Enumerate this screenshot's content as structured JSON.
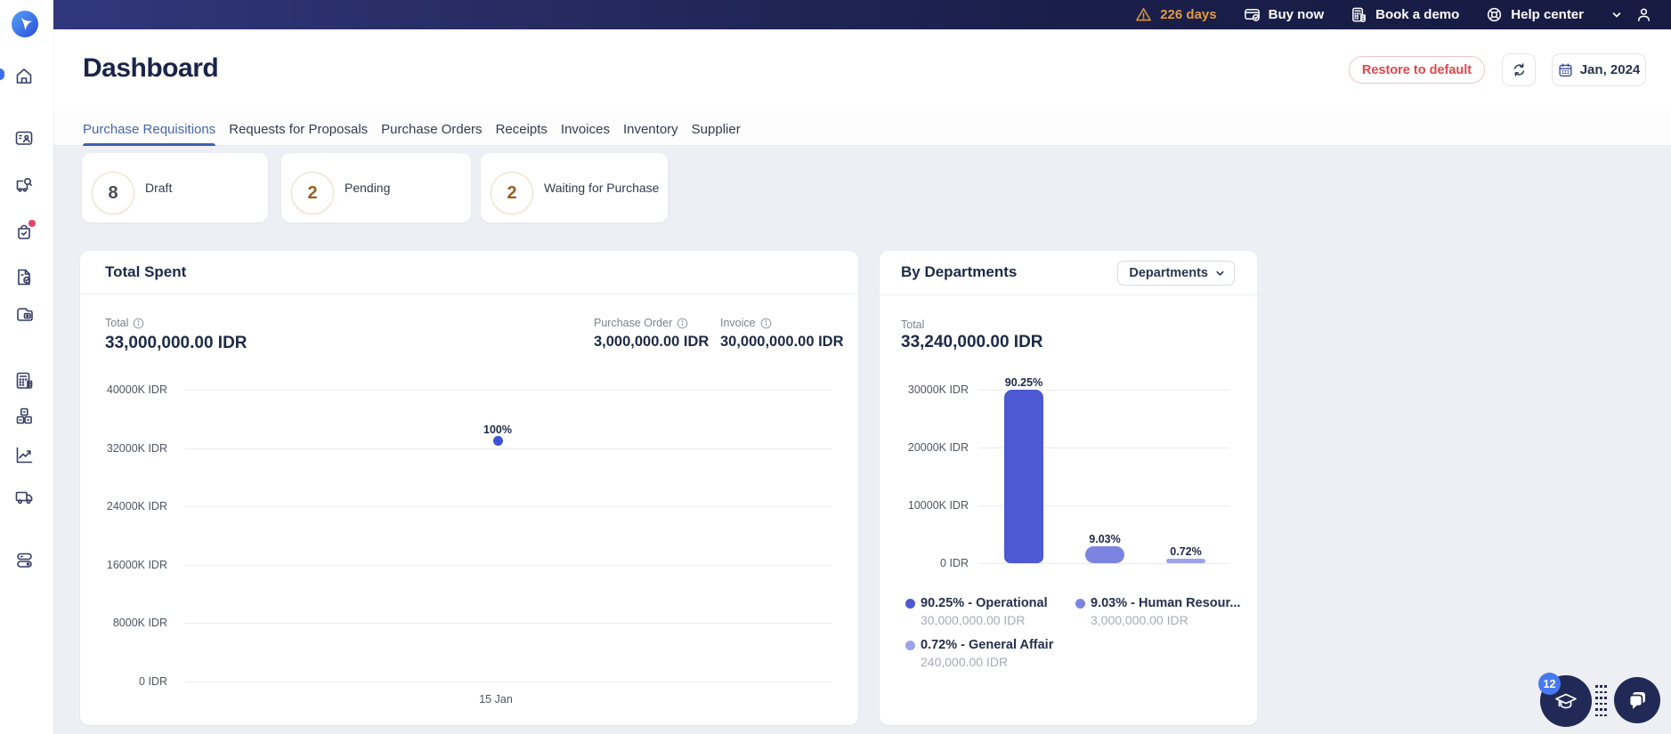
{
  "navbar": {
    "trial_days": "226 days",
    "items": [
      {
        "label": "Buy now",
        "icon": "wallet-check-icon"
      },
      {
        "label": "Book a demo",
        "icon": "calculator-icon"
      },
      {
        "label": "Help center",
        "icon": "lifebuoy-icon"
      }
    ]
  },
  "sidebar": {
    "icons": [
      "home",
      "id-card",
      "truck-search",
      "bag-check",
      "document-check",
      "wallet",
      "calculator",
      "cubes",
      "line-chart",
      "truck",
      "toggles"
    ]
  },
  "header": {
    "title": "Dashboard",
    "restore_label": "Restore to default",
    "date_label": "Jan, 2024"
  },
  "tabs": [
    {
      "label": "Purchase Requisitions",
      "active": true
    },
    {
      "label": "Requests for Proposals",
      "active": false
    },
    {
      "label": "Purchase Orders",
      "active": false
    },
    {
      "label": "Receipts",
      "active": false
    },
    {
      "label": "Invoices",
      "active": false
    },
    {
      "label": "Inventory",
      "active": false
    },
    {
      "label": "Supplier",
      "active": false
    }
  ],
  "status_cards": [
    {
      "count": "8",
      "label": "Draft",
      "count_color": "#4b4b53"
    },
    {
      "count": "2",
      "label": "Pending",
      "count_color": "#9c5d20"
    },
    {
      "count": "2",
      "label": "Waiting for Purchase",
      "count_color": "#9c5d20"
    }
  ],
  "total_spent": {
    "title": "Total Spent",
    "summary": [
      {
        "label": "Total",
        "value": "33,000,000.00 IDR"
      },
      {
        "label": "Purchase Order",
        "value": "3,000,000.00 IDR"
      },
      {
        "label": "Invoice",
        "value": "30,000,000.00 IDR"
      }
    ],
    "chart_data": {
      "type": "scatter",
      "x": [
        "15 Jan"
      ],
      "points": [
        {
          "x": "15 Jan",
          "value_idr": 33000000,
          "label": "100%"
        }
      ],
      "yticks": [
        "40000K IDR",
        "32000K IDR",
        "24000K IDR",
        "16000K IDR",
        "8000K IDR",
        "0 IDR"
      ],
      "ylim_idr": [
        0,
        40000000
      ],
      "point_color": "#3f51d3",
      "grid": true
    }
  },
  "by_departments": {
    "title": "By Departments",
    "filter_label": "Departments",
    "total_label": "Total",
    "total_value": "33,240,000.00 IDR",
    "chart_data": {
      "type": "bar",
      "categories": [
        "Operational",
        "Human Resources",
        "General Affair"
      ],
      "values_idr": [
        30000000,
        3000000,
        240000
      ],
      "percent_labels": [
        "90.25%",
        "9.03%",
        "0.72%"
      ],
      "yticks": [
        "30000K IDR",
        "20000K IDR",
        "10000K IDR",
        "0 IDR"
      ],
      "ylim_idr": [
        0,
        30000000
      ],
      "bar_colors": [
        "#4c59d3",
        "#7b84e0",
        "#9aa3ea"
      ],
      "legend": [
        {
          "label": "90.25% - Operational",
          "value": "30,000,000.00 IDR",
          "color": "#4c59d3"
        },
        {
          "label": "9.03% - Human Resour...",
          "value": "3,000,000.00 IDR",
          "color": "#7b84e0"
        },
        {
          "label": "0.72% - General Affair",
          "value": "240,000.00 IDR",
          "color": "#9aa3ea"
        }
      ]
    }
  },
  "floating": {
    "badge_count": "12"
  }
}
